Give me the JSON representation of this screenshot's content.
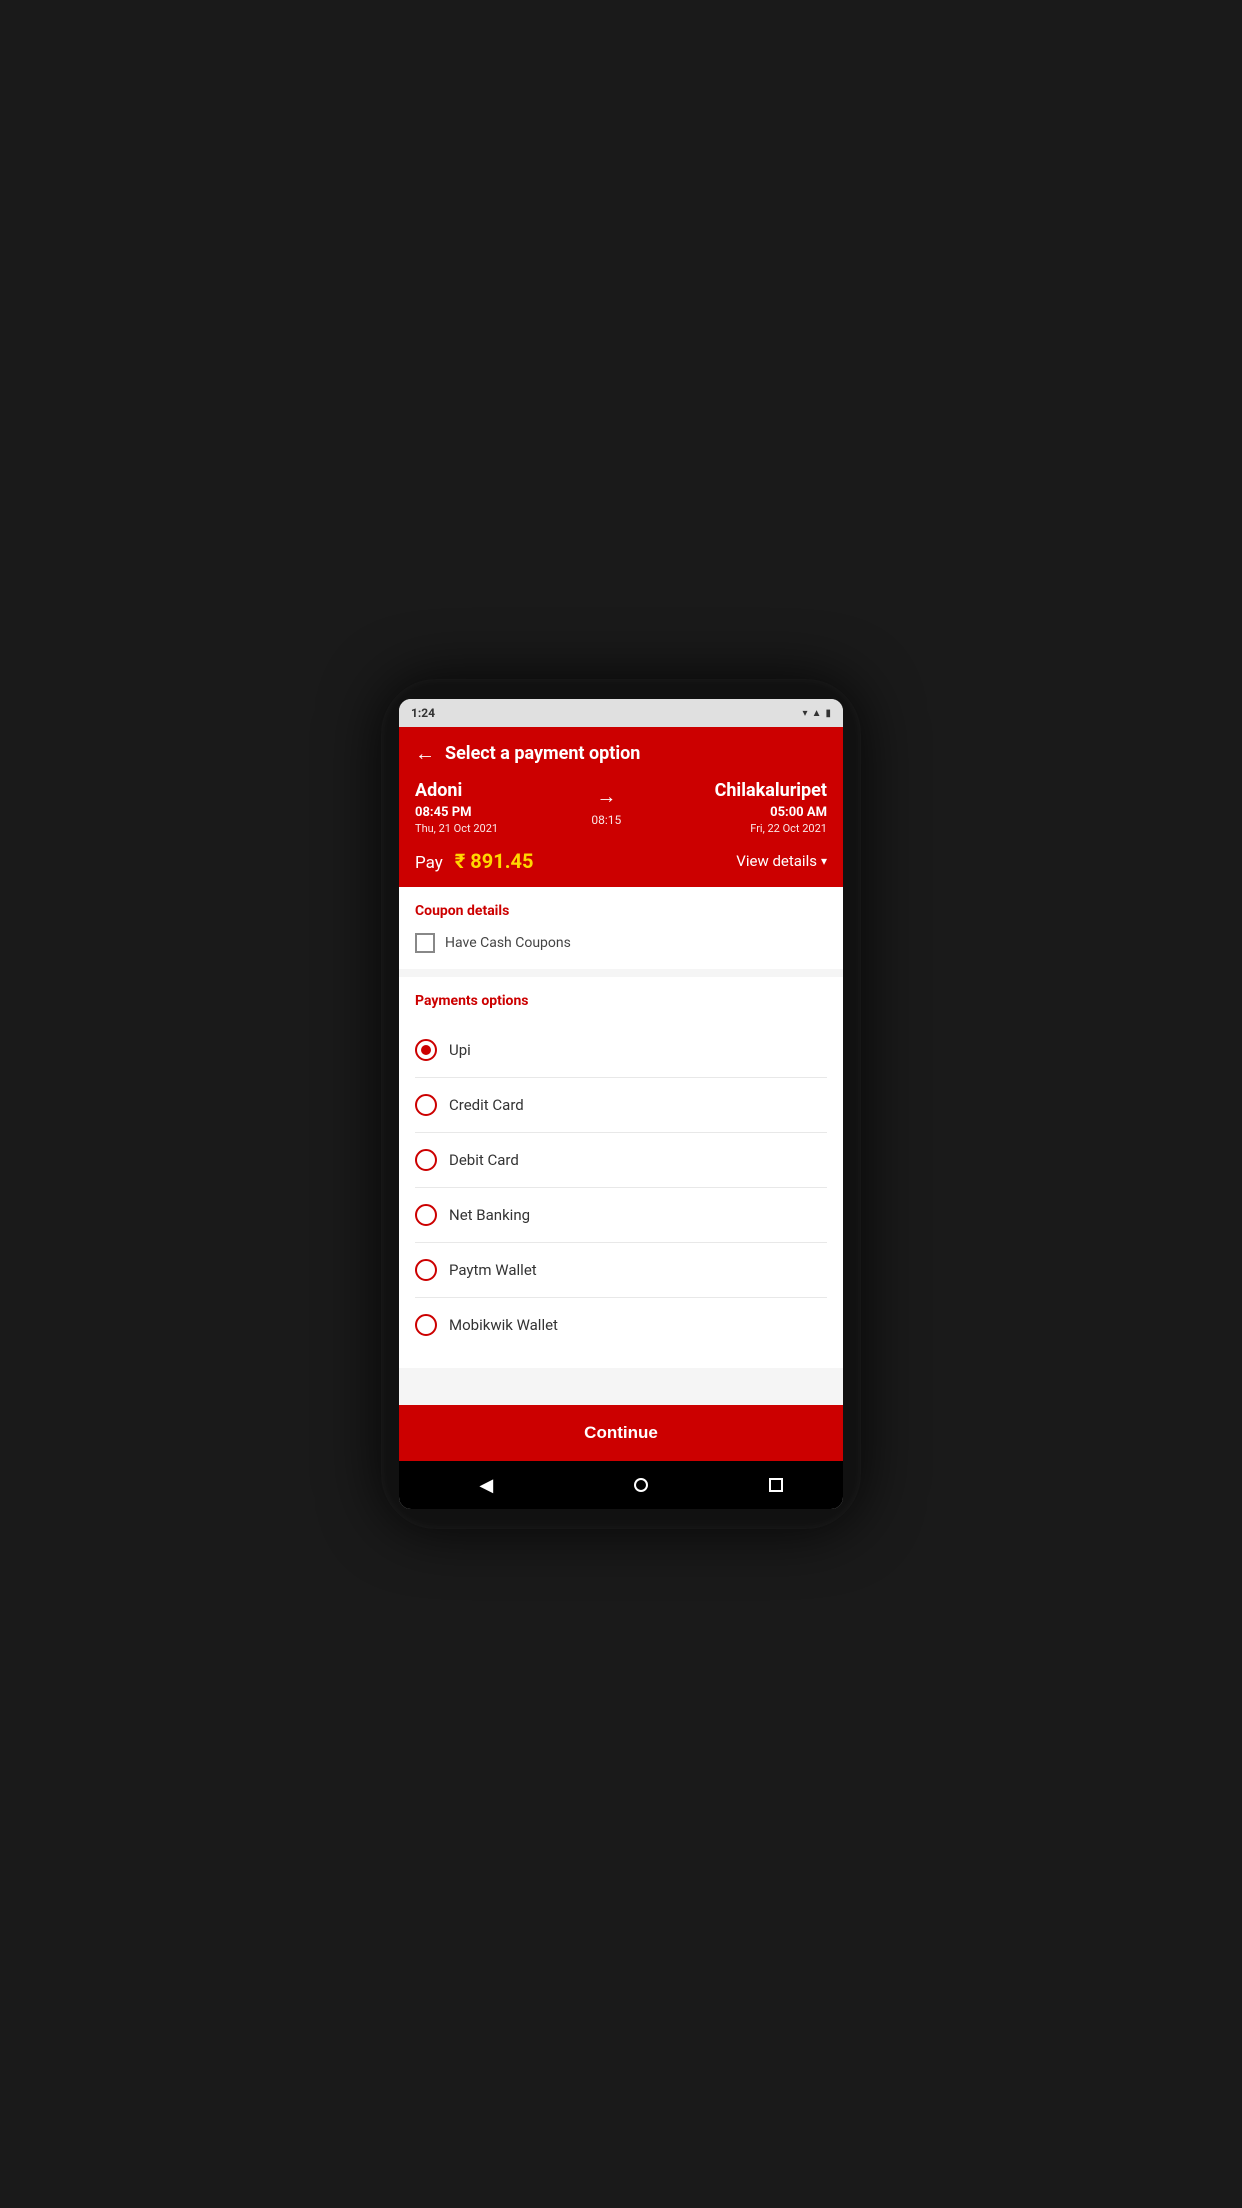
{
  "statusBar": {
    "time": "1:24",
    "icons": "▾◀ ▮"
  },
  "header": {
    "backLabel": "←",
    "title": "Select a payment option",
    "fromStation": "Adoni",
    "fromTime": "08:45 PM",
    "fromDate": "Thu, 21 Oct 2021",
    "arrowIcon": "→",
    "duration": "08:15",
    "toStation": "Chilakaluripet",
    "toTime": "05:00 AM",
    "toDate": "Fri, 22 Oct 2021",
    "payLabel": "Pay",
    "payAmount": "₹ 891.45",
    "viewDetailsLabel": "View details",
    "chevronIcon": "▾"
  },
  "couponSection": {
    "title": "Coupon details",
    "checkboxLabel": "Have Cash Coupons"
  },
  "paymentsSection": {
    "title": "Payments options",
    "options": [
      {
        "id": "upi",
        "label": "Upi",
        "selected": true
      },
      {
        "id": "credit-card",
        "label": "Credit Card",
        "selected": false
      },
      {
        "id": "debit-card",
        "label": "Debit Card",
        "selected": false
      },
      {
        "id": "net-banking",
        "label": "Net Banking",
        "selected": false
      },
      {
        "id": "paytm-wallet",
        "label": "Paytm Wallet",
        "selected": false
      },
      {
        "id": "mobikwik-wallet",
        "label": "Mobikwik Wallet",
        "selected": false
      }
    ]
  },
  "continueButton": {
    "label": "Continue"
  },
  "colors": {
    "primary": "#cc0000",
    "gold": "#ffd700"
  }
}
